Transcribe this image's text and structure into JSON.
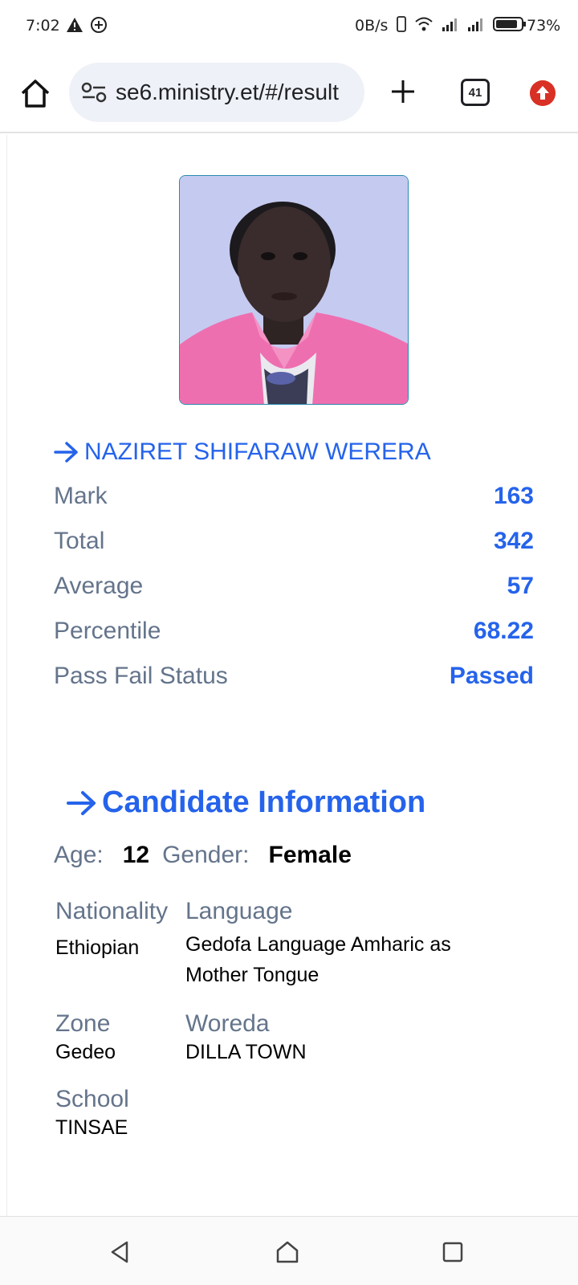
{
  "status_bar": {
    "time": "7:02",
    "net_speed": "0B/s",
    "battery": "73%"
  },
  "browser": {
    "url": "se6.ministry.et/#/result",
    "tab_count": "41"
  },
  "student": {
    "name": "NAZIRET SHIFARAW WERERA",
    "stats": [
      {
        "label": "Mark",
        "value": "163"
      },
      {
        "label": "Total",
        "value": "342"
      },
      {
        "label": "Average",
        "value": "57"
      },
      {
        "label": "Percentile",
        "value": "68.22"
      },
      {
        "label": "Pass Fail Status",
        "value": "Passed"
      }
    ]
  },
  "candidate": {
    "heading": "Candidate Information",
    "age_label": "Age:",
    "age": "12",
    "gender_label": "Gender:",
    "gender": "Female",
    "nationality_label": "Nationality",
    "nationality": "Ethiopian",
    "language_label": "Language",
    "language_line1": "Gedofa Language Amharic as",
    "language_line2": "Mother Tongue",
    "zone_label": "Zone",
    "zone": "Gedeo",
    "woreda_label": "Woreda",
    "woreda": "DILLA TOWN",
    "school_label": "School",
    "school": "TINSAE"
  },
  "colors": {
    "accent": "#2563eb",
    "label": "#64748b",
    "update_badge": "#d93025"
  }
}
